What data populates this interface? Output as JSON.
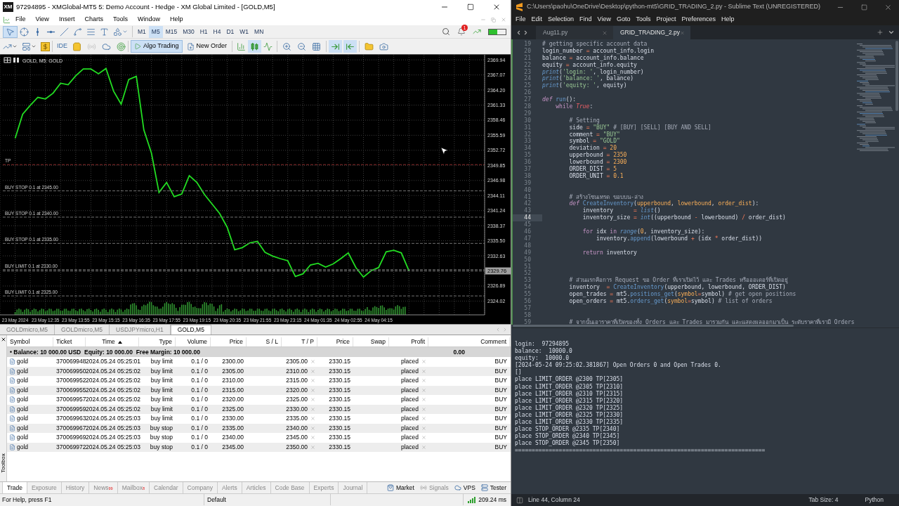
{
  "mt5": {
    "logo_text": "XM",
    "title": "97294895 - XMGlobal-MT5 5: Demo Account - Hedge - XM Global Limited - [GOLD,M5]",
    "menu": [
      "File",
      "View",
      "Insert",
      "Charts",
      "Tools",
      "Window",
      "Help"
    ],
    "tools": [
      {
        "kind": "cursor",
        "selected": true
      },
      {
        "kind": "crosshair",
        "selected": false
      },
      {
        "kind": "vline",
        "selected": false
      },
      {
        "kind": "hline",
        "selected": false
      },
      {
        "kind": "trend",
        "selected": false
      },
      {
        "kind": "spline",
        "selected": false
      },
      {
        "kind": "channel",
        "selected": false
      },
      {
        "kind": "text",
        "selected": false
      },
      {
        "kind": "shapes",
        "selected": false
      }
    ],
    "timeframes": [
      {
        "label": "M1",
        "selected": false
      },
      {
        "label": "M5",
        "selected": true
      },
      {
        "label": "M15",
        "selected": false
      },
      {
        "label": "M30",
        "selected": false
      },
      {
        "label": "H1",
        "selected": false
      },
      {
        "label": "H4",
        "selected": false
      },
      {
        "label": "D1",
        "selected": false
      },
      {
        "label": "W1",
        "selected": false
      },
      {
        "label": "MN",
        "selected": false
      }
    ],
    "notification_badge": "1",
    "ide_label": "IDE",
    "algo_trading": {
      "label": "Algo Trading",
      "on": true
    },
    "new_order_label": "New Order",
    "chart_types": [
      {
        "kind": "bars",
        "selected": false
      },
      {
        "kind": "candles",
        "selected": true
      },
      {
        "kind": "line",
        "selected": false
      }
    ],
    "auto_scroll": true,
    "chart_shift": true,
    "chart": {
      "header": "GOLD, M5: GOLD",
      "chart_data": {
        "type": "line",
        "ylim": [
          2321.4,
          2370.9
        ],
        "grid": true,
        "categories": [
          null,
          null,
          "23 May 2024",
          null,
          null,
          null,
          "23 May 12:35",
          null,
          null,
          null,
          "23 May 13:55",
          null,
          null,
          null,
          "23 May 15:15",
          null,
          null,
          null,
          "23 May 16:35",
          null,
          null,
          null,
          "23 May 17:55",
          null,
          null,
          null,
          "23 May 19:15",
          null,
          null,
          null,
          "23 May 20:35",
          null,
          null,
          null,
          "23 May 21:55",
          null,
          null,
          null,
          "23 May 23:15",
          null,
          null,
          null,
          "24 May 01:35",
          null,
          null,
          null,
          "24 May 02:55",
          null,
          null,
          null,
          "24 May 04:15",
          null,
          null,
          null,
          null,
          null,
          null,
          null,
          null,
          null,
          null,
          null,
          null,
          null,
          null
        ],
        "series": [
          {
            "color": "#22dd22",
            "values": [
              null,
              null,
              2355.0,
              2359.6,
              2361.3,
              2362.8,
              2362.5,
              2363.6,
              2365.5,
              2365.2,
              2366.9,
              2368.2,
              2368.2,
              2367.3,
              2368.3,
              2364.0,
              2361.5,
              2366.2,
              2366.8,
              2356.6,
              2352.2,
              2344.7,
              2346.6,
              2343.9,
              2344.4,
              2347.9,
              2346.6,
              2344.3,
              2342.5,
              2340.7,
              2338.1,
              2333.8,
              2334.2,
              2335.1,
              2335.4,
              2333.3,
              2332.6,
              2332.1,
              2331.7,
              2328.7,
              2329.2,
              2330.9,
              2331.2,
              2330.5,
              2331.1,
              2332.1,
              2333.2,
              2330.4,
              2328.6,
              2329.8,
              2330.4,
              2333.4,
              2333.7,
              2333.2,
              2329.8,
              null,
              null,
              null,
              null,
              null,
              null,
              null,
              null,
              null,
              null
            ]
          }
        ],
        "yticks": [
          {
            "value": 2324.02,
            "label": "2324.02"
          },
          {
            "value": 2326.89,
            "label": "2326.89"
          },
          {
            "value": 2332.63,
            "label": "2332.63"
          },
          {
            "value": 2335.5,
            "label": "2335.50"
          },
          {
            "value": 2338.37,
            "label": "2338.37"
          },
          {
            "value": 2341.24,
            "label": "2341.24"
          },
          {
            "value": 2344.11,
            "label": "2344.11"
          },
          {
            "value": 2346.98,
            "label": "2346.98"
          },
          {
            "value": 2349.85,
            "label": "2349.85"
          },
          {
            "value": 2352.72,
            "label": "2352.72"
          },
          {
            "value": 2355.59,
            "label": "2355.59"
          },
          {
            "value": 2358.46,
            "label": "2358.46"
          },
          {
            "value": 2361.33,
            "label": "2361.33"
          },
          {
            "value": 2364.2,
            "label": "2364.20"
          },
          {
            "value": 2367.07,
            "label": "2367.07"
          },
          {
            "value": 2369.94,
            "label": "2369.94"
          }
        ],
        "ref_lines": [
          {
            "axis": "y",
            "value": 2350,
            "label": "TP",
            "color": "#8b2b2b"
          },
          {
            "axis": "y",
            "value": 2345,
            "label": "BUY STOP 0.1 at 2345.00",
            "color": "#707070"
          },
          {
            "axis": "y",
            "value": 2340,
            "label": "BUY STOP 0.1 at 2340.00",
            "color": "#707070"
          },
          {
            "axis": "y",
            "value": 2335,
            "label": "BUY STOP 0.1 at 2335.00",
            "color": "#707070"
          },
          {
            "axis": "y",
            "value": 2330,
            "label": "BUY LIMIT 0.1 at 2330.00",
            "color": "#707070"
          },
          {
            "axis": "y",
            "value": 2325,
            "label": "BUY LIMIT 0.1 at 2325.00",
            "color": "#707070"
          },
          {
            "axis": "y",
            "value": 2329.76,
            "label": "2329.76",
            "color": "#7a7a7a"
          }
        ]
      }
    },
    "chart_tabs": [
      {
        "label": "GOLDmicro,M5",
        "selected": false
      },
      {
        "label": "GOLDmicro,M5",
        "selected": false
      },
      {
        "label": "USDJPYmicro,H1",
        "selected": false
      },
      {
        "label": "GOLD,M5",
        "selected": true
      }
    ],
    "table": {
      "columns": [
        {
          "label": "Symbol",
          "sorted": false
        },
        {
          "label": "Ticket",
          "sorted": false
        },
        {
          "label": "Time",
          "sorted": true
        },
        {
          "label": "Type",
          "sorted": false
        },
        {
          "label": "Volume",
          "sorted": false
        },
        {
          "label": "Price",
          "sorted": false
        },
        {
          "label": "S / L",
          "sorted": false
        },
        {
          "label": "T / P",
          "sorted": false
        },
        {
          "label": "Price",
          "sorted": false
        },
        {
          "label": "Swap",
          "sorted": false
        },
        {
          "label": "Profit",
          "sorted": false
        },
        {
          "label": "Comment",
          "sorted": false
        }
      ],
      "balance": "• Balance: 10 000.00 USD  Equity: 10 000.00  Free Margin: 10 000.00",
      "balance_profit": "0.00",
      "rows": [
        {
          "symbol": "gold",
          "ticket": "370069948",
          "time": "2024.05.24 05:25:01",
          "type": "buy limit",
          "volume": "0.1 / 0",
          "price": "2300.00",
          "tp": "2305.00",
          "current": "2330.15",
          "profit": "placed",
          "comment": "BUY"
        },
        {
          "symbol": "gold",
          "ticket": "370069950",
          "time": "2024.05.24 05:25:02",
          "type": "buy limit",
          "volume": "0.1 / 0",
          "price": "2305.00",
          "tp": "2310.00",
          "current": "2330.15",
          "profit": "placed",
          "comment": "BUY"
        },
        {
          "symbol": "gold",
          "ticket": "370069952",
          "time": "2024.05.24 05:25:02",
          "type": "buy limit",
          "volume": "0.1 / 0",
          "price": "2310.00",
          "tp": "2315.00",
          "current": "2330.15",
          "profit": "placed",
          "comment": "BUY"
        },
        {
          "symbol": "gold",
          "ticket": "370069955",
          "time": "2024.05.24 05:25:02",
          "type": "buy limit",
          "volume": "0.1 / 0",
          "price": "2315.00",
          "tp": "2320.00",
          "current": "2330.15",
          "profit": "placed",
          "comment": "BUY"
        },
        {
          "symbol": "gold",
          "ticket": "370069957",
          "time": "2024.05.24 05:25:02",
          "type": "buy limit",
          "volume": "0.1 / 0",
          "price": "2320.00",
          "tp": "2325.00",
          "current": "2330.15",
          "profit": "placed",
          "comment": "BUY"
        },
        {
          "symbol": "gold",
          "ticket": "370069959",
          "time": "2024.05.24 05:25:02",
          "type": "buy limit",
          "volume": "0.1 / 0",
          "price": "2325.00",
          "tp": "2330.00",
          "current": "2330.15",
          "profit": "placed",
          "comment": "BUY"
        },
        {
          "symbol": "gold",
          "ticket": "370069963",
          "time": "2024.05.24 05:25:03",
          "type": "buy limit",
          "volume": "0.1 / 0",
          "price": "2330.00",
          "tp": "2335.00",
          "current": "2330.15",
          "profit": "placed",
          "comment": "BUY"
        },
        {
          "symbol": "gold",
          "ticket": "370069967",
          "time": "2024.05.24 05:25:03",
          "type": "buy stop",
          "volume": "0.1 / 0",
          "price": "2335.00",
          "tp": "2340.00",
          "current": "2330.15",
          "profit": "placed",
          "comment": "BUY"
        },
        {
          "symbol": "gold",
          "ticket": "370069969",
          "time": "2024.05.24 05:25:03",
          "type": "buy stop",
          "volume": "0.1 / 0",
          "price": "2340.00",
          "tp": "2345.00",
          "current": "2330.15",
          "profit": "placed",
          "comment": "BUY"
        },
        {
          "symbol": "gold",
          "ticket": "370069972",
          "time": "2024.05.24 05:25:03",
          "type": "buy stop",
          "volume": "0.1 / 0",
          "price": "2345.00",
          "tp": "2350.00",
          "current": "2330.15",
          "profit": "placed",
          "comment": "BUY"
        }
      ]
    },
    "toolbox_label": "Toolbox",
    "bottom_tabs": [
      {
        "label": "Trade",
        "selected": true
      },
      {
        "label": "Exposure",
        "selected": false
      },
      {
        "label": "History",
        "selected": false
      },
      {
        "label": "News",
        "badge": "99",
        "selected": false
      },
      {
        "label": "Mailbox",
        "badge": "8",
        "selected": false
      },
      {
        "label": "Calendar",
        "selected": false
      },
      {
        "label": "Company",
        "selected": false
      },
      {
        "label": "Alerts",
        "selected": false
      },
      {
        "label": "Articles",
        "selected": false
      },
      {
        "label": "Code Base",
        "selected": false
      },
      {
        "label": "Experts",
        "selected": false
      },
      {
        "label": "Journal",
        "selected": false
      }
    ],
    "services": [
      {
        "kind": "market",
        "label": "Market",
        "disabled": false
      },
      {
        "kind": "signals",
        "label": "Signals",
        "disabled": true
      },
      {
        "kind": "vps",
        "label": "VPS",
        "disabled": false
      },
      {
        "kind": "tester",
        "label": "Tester",
        "disabled": false
      }
    ],
    "status": {
      "help": "For Help, press F1",
      "profile": "Default",
      "ping": "209.24 ms"
    }
  },
  "sublime": {
    "title": "C:\\Users\\paohu\\OneDrive\\Desktop\\python-mt5\\GRID_TRADING_2.py - Sublime Text (UNREGISTERED)",
    "menu": [
      "File",
      "Edit",
      "Selection",
      "Find",
      "View",
      "Goto",
      "Tools",
      "Project",
      "Preferences",
      "Help"
    ],
    "tabs": [
      {
        "label": "Aug11.py",
        "selected": false
      },
      {
        "label": "GRID_TRADING_2.py",
        "selected": true
      }
    ],
    "lines": [
      {
        "number": "19",
        "current": false,
        "tokens": [
          {
            "kind": "comment",
            "text": "# getting specific account data"
          }
        ]
      },
      {
        "number": "20",
        "current": false,
        "tokens": [
          {
            "kind": "plain",
            "text": "login_number "
          },
          {
            "kind": "op",
            "text": "="
          },
          {
            "kind": "plain",
            "text": " account_info.login"
          }
        ]
      },
      {
        "number": "21",
        "current": false,
        "tokens": [
          {
            "kind": "plain",
            "text": "balance "
          },
          {
            "kind": "op",
            "text": "="
          },
          {
            "kind": "plain",
            "text": " account_info.balance"
          }
        ]
      },
      {
        "number": "22",
        "current": false,
        "tokens": [
          {
            "kind": "plain",
            "text": "equity "
          },
          {
            "kind": "op",
            "text": "="
          },
          {
            "kind": "plain",
            "text": " account_info.equity"
          }
        ]
      },
      {
        "number": "23",
        "current": false,
        "tokens": [
          {
            "kind": "builtin",
            "text": "print"
          },
          {
            "kind": "plain",
            "text": "("
          },
          {
            "kind": "string",
            "text": "'login: '"
          },
          {
            "kind": "plain",
            "text": ", login_number)"
          }
        ]
      },
      {
        "number": "24",
        "current": false,
        "tokens": [
          {
            "kind": "builtin",
            "text": "print"
          },
          {
            "kind": "plain",
            "text": "("
          },
          {
            "kind": "string",
            "text": "'balance: '"
          },
          {
            "kind": "plain",
            "text": ", balance)"
          }
        ]
      },
      {
        "number": "25",
        "current": false,
        "tokens": [
          {
            "kind": "builtin",
            "text": "print"
          },
          {
            "kind": "plain",
            "text": "("
          },
          {
            "kind": "string",
            "text": "'equity: '"
          },
          {
            "kind": "plain",
            "text": ", equity)"
          }
        ]
      },
      {
        "number": "26",
        "current": false
      },
      {
        "number": "27",
        "current": false,
        "tokens": [
          {
            "kind": "storage",
            "text": "def "
          },
          {
            "kind": "func",
            "text": "run"
          },
          {
            "kind": "plain",
            "text": "():"
          }
        ]
      },
      {
        "number": "28",
        "current": false,
        "tokens": [
          {
            "kind": "keyword",
            "text": "    while "
          },
          {
            "kind": "constant",
            "text": "True"
          },
          {
            "kind": "plain",
            "text": ":"
          }
        ]
      },
      {
        "number": "29",
        "current": false
      },
      {
        "number": "30",
        "current": false,
        "tokens": [
          {
            "kind": "comment",
            "text": "        # Setting"
          }
        ]
      },
      {
        "number": "31",
        "current": false,
        "tokens": [
          {
            "kind": "plain",
            "text": "        side "
          },
          {
            "kind": "op",
            "text": "="
          },
          {
            "kind": "string",
            "text": " \"BUY\" "
          },
          {
            "kind": "comment",
            "text": "# [BUY] [SELL] [BUY AND SELL]"
          }
        ]
      },
      {
        "number": "32",
        "current": false,
        "tokens": [
          {
            "kind": "plain",
            "text": "        comment "
          },
          {
            "kind": "op",
            "text": "="
          },
          {
            "kind": "string",
            "text": " \"BUY\""
          }
        ]
      },
      {
        "number": "33",
        "current": false,
        "tokens": [
          {
            "kind": "plain",
            "text": "        symbol "
          },
          {
            "kind": "op",
            "text": "="
          },
          {
            "kind": "string",
            "text": " \"GOLD\""
          }
        ]
      },
      {
        "number": "34",
        "current": false,
        "tokens": [
          {
            "kind": "plain",
            "text": "        deviation "
          },
          {
            "kind": "op",
            "text": "="
          },
          {
            "kind": "number",
            "text": " 20"
          }
        ]
      },
      {
        "number": "35",
        "current": false,
        "tokens": [
          {
            "kind": "plain",
            "text": "        upperbound "
          },
          {
            "kind": "op",
            "text": "="
          },
          {
            "kind": "number",
            "text": " 2350"
          }
        ]
      },
      {
        "number": "36",
        "current": false,
        "tokens": [
          {
            "kind": "plain",
            "text": "        lowerbound "
          },
          {
            "kind": "op",
            "text": "="
          },
          {
            "kind": "number",
            "text": " 2300"
          }
        ]
      },
      {
        "number": "37",
        "current": false,
        "tokens": [
          {
            "kind": "plain",
            "text": "        ORDER_DIST "
          },
          {
            "kind": "op",
            "text": "="
          },
          {
            "kind": "number",
            "text": " 5"
          }
        ]
      },
      {
        "number": "38",
        "current": false,
        "tokens": [
          {
            "kind": "plain",
            "text": "        ORDER_UNIT "
          },
          {
            "kind": "op",
            "text": "="
          },
          {
            "kind": "number",
            "text": " 0.1"
          }
        ]
      },
      {
        "number": "39",
        "current": false
      },
      {
        "number": "40",
        "current": false
      },
      {
        "number": "41",
        "current": false,
        "tokens": [
          {
            "kind": "comment",
            "text": "        # สร้างโซนเทรด ขอบบน-ล่าง"
          }
        ]
      },
      {
        "number": "42",
        "current": false,
        "tokens": [
          {
            "kind": "storage",
            "text": "        def "
          },
          {
            "kind": "func",
            "text": "CreateInventory"
          },
          {
            "kind": "plain",
            "text": "("
          },
          {
            "kind": "param",
            "text": "upperbound"
          },
          {
            "kind": "plain",
            "text": ", "
          },
          {
            "kind": "param",
            "text": "lowerbound"
          },
          {
            "kind": "plain",
            "text": ", "
          },
          {
            "kind": "param",
            "text": "order_dist"
          },
          {
            "kind": "plain",
            "text": "):"
          }
        ]
      },
      {
        "number": "43",
        "current": false,
        "tokens": [
          {
            "kind": "plain",
            "text": "            inventory      "
          },
          {
            "kind": "op",
            "text": "="
          },
          {
            "kind": "builtin",
            "text": " list"
          },
          {
            "kind": "plain",
            "text": "()"
          }
        ]
      },
      {
        "number": "44",
        "current": true,
        "tokens": [
          {
            "kind": "plain",
            "text": "            inventory_size "
          },
          {
            "kind": "op",
            "text": "="
          },
          {
            "kind": "builtin",
            "text": " int"
          },
          {
            "kind": "plain",
            "text": "((upperbound "
          },
          {
            "kind": "op",
            "text": "-"
          },
          {
            "kind": "plain",
            "text": " lowerbound) "
          },
          {
            "kind": "op",
            "text": "/"
          },
          {
            "kind": "plain",
            "text": " order_dist)"
          }
        ]
      },
      {
        "number": "45",
        "current": false
      },
      {
        "number": "46",
        "current": false,
        "tokens": [
          {
            "kind": "keyword",
            "text": "            for"
          },
          {
            "kind": "plain",
            "text": " idx "
          },
          {
            "kind": "keyword",
            "text": "in"
          },
          {
            "kind": "builtin",
            "text": " range"
          },
          {
            "kind": "plain",
            "text": "("
          },
          {
            "kind": "number",
            "text": "0"
          },
          {
            "kind": "plain",
            "text": ", inventory_size):"
          }
        ]
      },
      {
        "number": "47",
        "current": false,
        "tokens": [
          {
            "kind": "plain",
            "text": "                inventory."
          },
          {
            "kind": "func",
            "text": "append"
          },
          {
            "kind": "plain",
            "text": "(lowerbound "
          },
          {
            "kind": "op",
            "text": "+"
          },
          {
            "kind": "plain",
            "text": " (idx "
          },
          {
            "kind": "op",
            "text": "*"
          },
          {
            "kind": "plain",
            "text": " order_dist))"
          }
        ]
      },
      {
        "number": "48",
        "current": false
      },
      {
        "number": "49",
        "current": false,
        "tokens": [
          {
            "kind": "keyword",
            "text": "            return"
          },
          {
            "kind": "plain",
            "text": " inventory"
          }
        ]
      },
      {
        "number": "50",
        "current": false
      },
      {
        "number": "51",
        "current": false
      },
      {
        "number": "52",
        "current": false
      },
      {
        "number": "53",
        "current": false,
        "tokens": [
          {
            "kind": "comment",
            "text": "        # ส่วนแรกคือการ Request ขอ Order ที่เราเปิดไว้ และ Trades หรือออเดอร์ที่เปิดอยู่"
          }
        ]
      },
      {
        "number": "54",
        "current": false,
        "tokens": [
          {
            "kind": "plain",
            "text": "        inventory  "
          },
          {
            "kind": "op",
            "text": "="
          },
          {
            "kind": "func",
            "text": " CreateInventory"
          },
          {
            "kind": "plain",
            "text": "(upperbound, lowerbound, ORDER_DIST)"
          }
        ]
      },
      {
        "number": "55",
        "current": false,
        "tokens": [
          {
            "kind": "plain",
            "text": "        open_trades "
          },
          {
            "kind": "op",
            "text": "="
          },
          {
            "kind": "plain",
            "text": " mt5."
          },
          {
            "kind": "func",
            "text": "positions_get"
          },
          {
            "kind": "plain",
            "text": "("
          },
          {
            "kind": "param",
            "text": "symbol"
          },
          {
            "kind": "op",
            "text": "="
          },
          {
            "kind": "plain",
            "text": "symbol) "
          },
          {
            "kind": "comment",
            "text": "# get open positions"
          }
        ]
      },
      {
        "number": "56",
        "current": false,
        "tokens": [
          {
            "kind": "plain",
            "text": "        open_orders "
          },
          {
            "kind": "op",
            "text": "="
          },
          {
            "kind": "plain",
            "text": " mt5."
          },
          {
            "kind": "func",
            "text": "orders_get"
          },
          {
            "kind": "plain",
            "text": "("
          },
          {
            "kind": "param",
            "text": "symbol"
          },
          {
            "kind": "op",
            "text": "="
          },
          {
            "kind": "plain",
            "text": "symbol) "
          },
          {
            "kind": "comment",
            "text": "# list of orders"
          }
        ]
      },
      {
        "number": "57",
        "current": false
      },
      {
        "number": "58",
        "current": false
      },
      {
        "number": "59",
        "current": false,
        "tokens": [
          {
            "kind": "comment",
            "text": "        # จากนั้นเอาราคาที่เปิดของทั้ง Orders และ Trades มารวมกัน และแสดงผลออกมาเป็น ระดับราคาที่เรามี Orders"
          }
        ]
      }
    ],
    "console": [
      "login:  97294895",
      "balance:  10000.0",
      "equity:  10000.0",
      "[2024-05-24 09:25:02.381867] Open Orders 0 and Open Trades 0.",
      "[]",
      "place LIMIT_ORDER @2300 TP[2305]",
      "place LIMIT_ORDER @2305 TP[2310]",
      "place LIMIT_ORDER @2310 TP[2315]",
      "place LIMIT_ORDER @2315 TP[2320]",
      "place LIMIT_ORDER @2320 TP[2325]",
      "place LIMIT_ORDER @2325 TP[2330]",
      "place LIMIT_ORDER @2330 TP[2335]",
      "place STOP_ORDER @2335 TP[2340]",
      "place STOP_ORDER @2340 TP[2345]",
      "place STOP_ORDER @2345 TP[2350]",
      "=========================================================================="
    ],
    "status": {
      "position": "Line 44, Column 24",
      "tab_size": "Tab Size: 4",
      "syntax": "Python"
    }
  }
}
